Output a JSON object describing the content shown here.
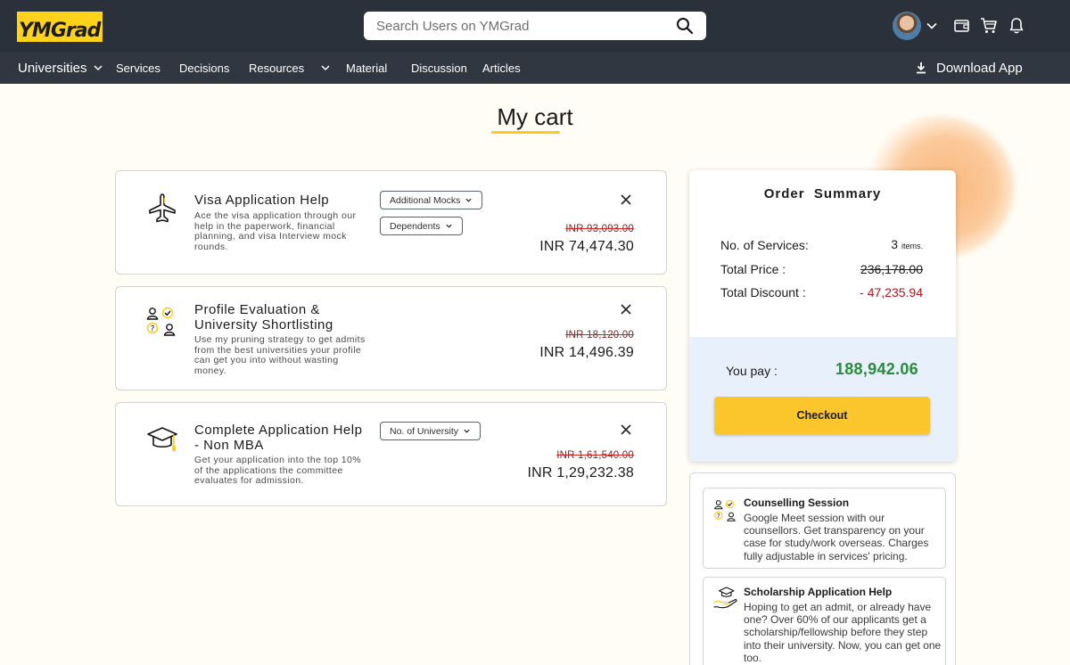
{
  "header": {
    "logo_text_a": "YM",
    "logo_text_b": "Grad",
    "search_placeholder": "Search Users on YMGrad"
  },
  "nav": {
    "items": [
      {
        "label": "Universities",
        "has_dropdown": true
      },
      {
        "label": "Services",
        "has_dropdown": false
      },
      {
        "label": "Decisions",
        "has_dropdown": false
      },
      {
        "label": "Resources",
        "has_dropdown": true
      },
      {
        "label": "Material",
        "has_dropdown": false
      },
      {
        "label": "Discussion",
        "has_dropdown": false
      },
      {
        "label": "Articles",
        "has_dropdown": false
      }
    ],
    "download_label": "Download App"
  },
  "page": {
    "title": "My cart"
  },
  "cart": {
    "items": [
      {
        "title": "Visa Application Help",
        "description": "Ace the visa application through our help in the paperwork, financial planning, and visa Interview mock rounds.",
        "options": [
          "Additional Mocks",
          "Dependents"
        ],
        "old_price": "INR 93,093.00",
        "new_price": "INR 74,474.30",
        "icon": "airplane-icon"
      },
      {
        "title_line1": "Profile Evaluation &",
        "title_line2": "University Shortlisting",
        "description": "Use my pruning strategy to get admits from the best universities your profile can get you into without wasting money.",
        "old_price": "INR 18,120.00",
        "new_price": "INR 14,496.39",
        "icon": "profile-evaluation-icon"
      },
      {
        "title_line1": "Complete Application Help",
        "title_line2": "- Non MBA",
        "description": "Get your application into the top 10% of the applications the committee evaluates for admission.",
        "options": [
          "No. of University"
        ],
        "old_price": "INR 1,61,540.00",
        "new_price": "INR 1,29,232.38",
        "icon": "graduation-cap-icon"
      }
    ]
  },
  "summary": {
    "title": "Order  Summary",
    "services_label": "No. of Services:",
    "services_count": "3",
    "services_unit": "items.",
    "total_price_label": "Total Price :",
    "total_price": "236,178.00",
    "total_discount_label": "Total Discount :",
    "total_discount": "- 47,235.94",
    "you_pay_label": "You pay :",
    "you_pay": "188,942.06",
    "checkout_label": "Checkout"
  },
  "recommendations": [
    {
      "title": "Counselling Session",
      "description": "Google Meet session with our counsellors. Get transparency on your case for study/work overseas. Charges fully adjustable in services' pricing.",
      "icon": "counselling-icon"
    },
    {
      "title": "Scholarship Application Help",
      "description": "Hoping to get an admit, or already have one? Over 60% of our applicants get a scholarship/fellowship before they step into their university. Now, you can get one too.",
      "icon": "scholarship-icon"
    }
  ],
  "colors": {
    "header_bg": "#2b313b",
    "nav_bg": "#303741",
    "brand_yellow": "#ffd21c",
    "checkout_yellow": "#fbc52c",
    "pay_green": "#2b8a3e",
    "discount_red": "#b3121e"
  }
}
